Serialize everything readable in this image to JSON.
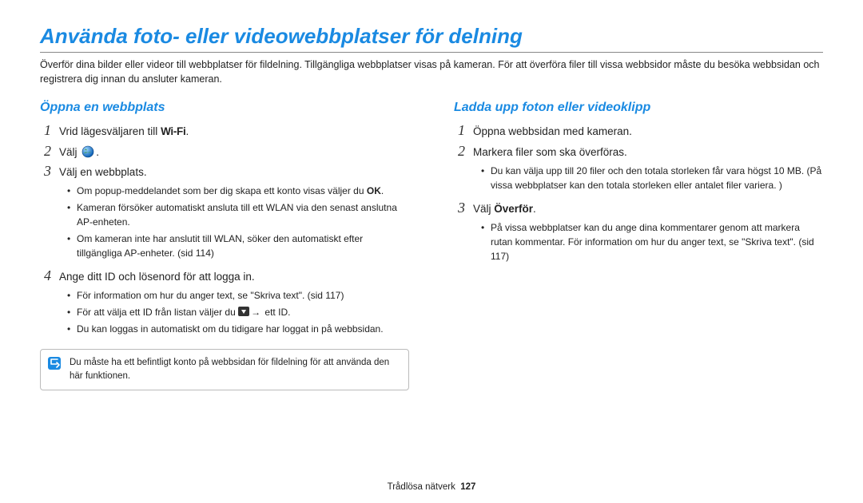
{
  "page_title": "Använda foto- eller videowebbplatser för delning",
  "intro": "Överför dina bilder eller videor till webbplatser för fildelning. Tillgängliga webbplatser visas på kameran. För att överföra filer till vissa webbsidor måste du besöka webbsidan och registrera dig innan du ansluter kameran.",
  "left": {
    "section_title": "Öppna en webbplats",
    "items": {
      "i1_prefix": "Vrid lägesväljaren till ",
      "i1_wifi": "Wi-Fi",
      "i1_suffix": ".",
      "i2_prefix": "Välj ",
      "i2_suffix": ".",
      "i3": "Välj en webbplats.",
      "i3_bullets": {
        "b1_pre": "Om popup-meddelandet som ber dig skapa ett konto visas väljer du ",
        "b1_bold": "OK",
        "b1_post": ".",
        "b2": "Kameran försöker automatiskt ansluta till ett WLAN via den senast anslutna AP-enheten.",
        "b3": "Om kameran inte har anslutit till WLAN, söker den automatiskt efter tillgängliga AP-enheter. (sid 114)"
      },
      "i4": "Ange ditt ID och lösenord för att logga in.",
      "i4_bullets": {
        "b1": "För information om hur du anger text, se \"Skriva text\". (sid 117)",
        "b2_pre": "För att välja ett ID från listan väljer du ",
        "b2_arrow": "→",
        "b2_post": " ett ID.",
        "b3": "Du kan loggas in automatiskt om du tidigare har loggat in på webbsidan."
      }
    },
    "note": "Du måste ha ett befintligt konto på webbsidan för fildelning för att använda den här funktionen."
  },
  "right": {
    "section_title": "Ladda upp foton eller videoklipp",
    "items": {
      "i1": "Öppna webbsidan med kameran.",
      "i2": "Markera filer som ska överföras.",
      "i2_bullets": {
        "b1": "Du kan välja upp till 20 filer och den totala storleken får vara högst 10 MB. (På vissa webbplatser kan den totala storleken eller antalet filer variera. )"
      },
      "i3_pre": "Välj ",
      "i3_bold": "Överför",
      "i3_post": ".",
      "i3_bullets": {
        "b1": "På vissa webbplatser kan du ange dina kommentarer genom att markera rutan kommentar. För information om hur du anger text, se \"Skriva text\". (sid 117)"
      }
    }
  },
  "footer": {
    "section": "Trådlösa nätverk",
    "page_number": "127"
  },
  "numbers": {
    "n1": "1",
    "n2": "2",
    "n3": "3",
    "n4": "4"
  }
}
